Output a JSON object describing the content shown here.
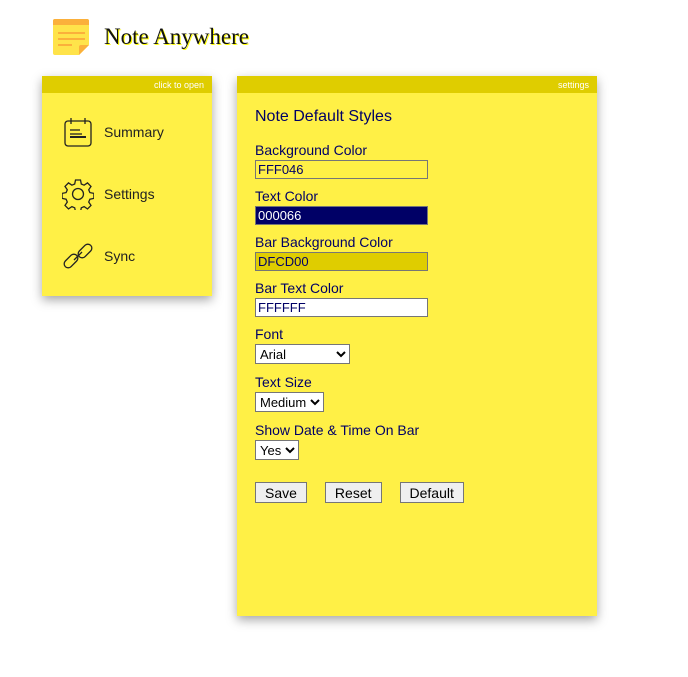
{
  "app": {
    "title": "Note Anywhere",
    "logo_icon": "sticky-note-icon"
  },
  "menu": {
    "bar_text": "click to open",
    "items": [
      {
        "label": "Summary",
        "icon": "calendar-notes-icon"
      },
      {
        "label": "Settings",
        "icon": "gear-icon"
      },
      {
        "label": "Sync",
        "icon": "link-icon"
      }
    ]
  },
  "settings": {
    "bar_text": "settings",
    "heading": "Note Default Styles",
    "background_color": {
      "label": "Background Color",
      "value": "FFF046"
    },
    "text_color": {
      "label": "Text Color",
      "value": "000066"
    },
    "bar_background_color": {
      "label": "Bar Background Color",
      "value": "DFCD00"
    },
    "bar_text_color": {
      "label": "Bar Text Color",
      "value": "FFFFFF"
    },
    "font": {
      "label": "Font",
      "value": "Arial"
    },
    "text_size": {
      "label": "Text Size",
      "value": "Medium"
    },
    "show_date": {
      "label": "Show Date & Time On Bar",
      "value": "Yes"
    },
    "buttons": {
      "save": "Save",
      "reset": "Reset",
      "default": "Default"
    }
  },
  "colors": {
    "note_bg": "#FFF046",
    "text": "#000066",
    "bar_bg": "#DFCD00",
    "bar_text": "#FFFFFF"
  }
}
